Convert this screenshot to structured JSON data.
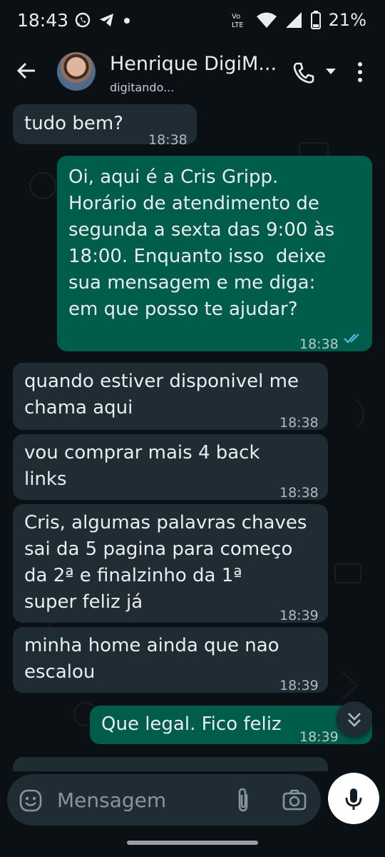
{
  "status_bar": {
    "time": "18:43",
    "network": "Vo LTE",
    "battery": "21%"
  },
  "header": {
    "contact_name": "Henrique DigiM...",
    "status": "digitando..."
  },
  "messages": [
    {
      "dir": "in",
      "text": "tudo bem?",
      "time": "18:38"
    },
    {
      "dir": "out",
      "text": "Oi, aqui é a Cris Gripp.\nHorário de atendimento de\nsegunda a sexta das 9:00 às\n18:00. Enquanto isso  deixe\nsua mensagem e me diga:\nem que posso te ajudar?",
      "time": "18:38",
      "status": "read"
    },
    {
      "dir": "in",
      "text": "quando estiver disponivel me\nchama aqui",
      "time": "18:38"
    },
    {
      "dir": "in",
      "text": "vou comprar mais 4 back\nlinks",
      "time": "18:38"
    },
    {
      "dir": "in",
      "text": "Cris, algumas palavras chaves\nsai da 5 pagina para começo\nda 2ª e finalzinho da 1ª\nsuper feliz já",
      "time": "18:39"
    },
    {
      "dir": "in",
      "text": "minha home ainda que nao\nescalou",
      "time": "18:39"
    },
    {
      "dir": "out",
      "text": "Que legal. Fico feliz",
      "time": "18:39"
    }
  ],
  "input": {
    "placeholder": "Mensagem"
  },
  "colors": {
    "background": "#0b1014",
    "incoming_bubble": "#202c33",
    "outgoing_bubble": "#005c4b",
    "read_ticks": "#53bdeb"
  }
}
